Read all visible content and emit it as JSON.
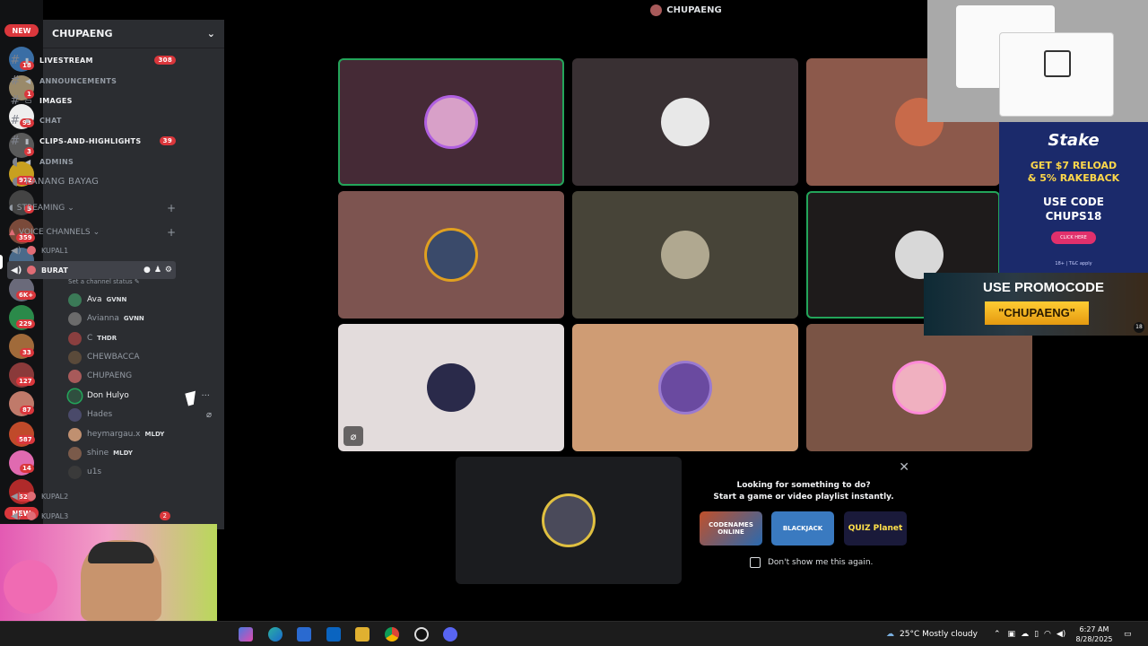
{
  "window": {
    "title": "CHUPAENG"
  },
  "guilds": {
    "new_top": "NEW",
    "new_bottom": "NEW",
    "badges": [
      "18",
      "1",
      "93",
      "3",
      "972",
      "5",
      "359",
      "349",
      "6K+",
      "229",
      "33",
      "127",
      "87",
      "587",
      "14",
      "526"
    ]
  },
  "server": {
    "name": "CHUPAENG"
  },
  "channels": [
    {
      "label": "LIVESTREAM",
      "count": "308",
      "unread": true
    },
    {
      "label": "ANNOUNCEMENTS",
      "count": "",
      "unread": false
    },
    {
      "label": "IMAGES",
      "count": "",
      "unread": true
    },
    {
      "label": "CHAT",
      "count": "",
      "unread": false
    },
    {
      "label": "CLIPS-AND-HIGHLIGHTS",
      "count": "39",
      "unread": true
    },
    {
      "label": "ADMINS",
      "count": "",
      "unread": false
    }
  ],
  "stage_channel": "KANANG BAYAG",
  "categories": {
    "streaming": "STREAMING",
    "voice": "VOICE CHANNELS"
  },
  "voice_channels": {
    "kupal1": "KUPAL1",
    "burat": "BURAT",
    "kupal2": "KUPAL2",
    "kupal3": "KUPAL3",
    "kupal3_count": "2"
  },
  "channel_status": "Set a channel status",
  "voice_users": [
    {
      "name": "Ava",
      "tag": "GVNN",
      "color": "#3b7a57"
    },
    {
      "name": "Avianna",
      "tag": "GVNN",
      "color": "#6b6b6b"
    },
    {
      "name": "C",
      "tag": "THDR",
      "color": "#8a3f3f"
    },
    {
      "name": "CHEWBACCA",
      "tag": "",
      "color": "#5a4a3a"
    },
    {
      "name": "CHUPAENG",
      "tag": "",
      "color": "#a85a5a"
    },
    {
      "name": "Don Hulyo",
      "tag": "",
      "color": "#2f4f3f"
    },
    {
      "name": "Hades",
      "tag": "",
      "color": "#4a4a6a"
    },
    {
      "name": "heymargau.x",
      "tag": "MLDY",
      "color": "#c09070"
    },
    {
      "name": "shine",
      "tag": "MLDY",
      "color": "#7a5a4a"
    },
    {
      "name": "u1s",
      "tag": "",
      "color": "#3a3a3a"
    }
  ],
  "tiles": [
    {
      "bg": "#452a36",
      "speaking": true,
      "muted": false,
      "av": "#d8a0c8"
    },
    {
      "bg": "#393033",
      "speaking": false,
      "muted": false,
      "av": "#e8e8e8"
    },
    {
      "bg": "#8c594b",
      "speaking": false,
      "muted": false,
      "av": "#c86a4a"
    },
    {
      "bg": "#7d5450",
      "speaking": false,
      "muted": false,
      "av": "#3a4a6a"
    },
    {
      "bg": "#474438",
      "speaking": false,
      "muted": false,
      "av": "#b0a890"
    },
    {
      "bg": "#1e1b1b",
      "speaking": true,
      "muted": false,
      "av": "#d8d8d8"
    },
    {
      "bg": "#e3dcdc",
      "speaking": false,
      "muted": true,
      "av": "#2a2a4a"
    },
    {
      "bg": "#cf9c74",
      "speaking": false,
      "muted": false,
      "av": "#6a4aa0"
    },
    {
      "bg": "#7a5445",
      "speaking": false,
      "muted": false,
      "av": "#f0b0c0"
    },
    {
      "bg": "#1b1c1f",
      "speaking": false,
      "muted": false,
      "av": "#4a4a5a"
    }
  ],
  "activity_prompt": {
    "title": "Looking for something to do?",
    "subtitle": "Start a game or video playlist instantly.",
    "games": [
      "CODENAMES ONLINE",
      "BLACKJACK",
      "QUIZ Planet"
    ],
    "checkbox": "Don't show me this again."
  },
  "ads": {
    "stake_logo": "Stake",
    "stake_line1": "GET $7 RELOAD",
    "stake_line2": "& 5% RAKEBACK",
    "stake_line3": "USE CODE",
    "stake_line4": "CHUPS18",
    "stake_button": "CLICK HERE",
    "stake_fine": "18+ | T&C apply",
    "promo_line1": "USE PROMOCODE",
    "promo_line2": "\"CHUPAENG\"",
    "promo_age": "18"
  },
  "taskbar": {
    "weather": "25°C  Mostly cloudy",
    "time": "6:27 AM",
    "date": "8/28/2025"
  }
}
